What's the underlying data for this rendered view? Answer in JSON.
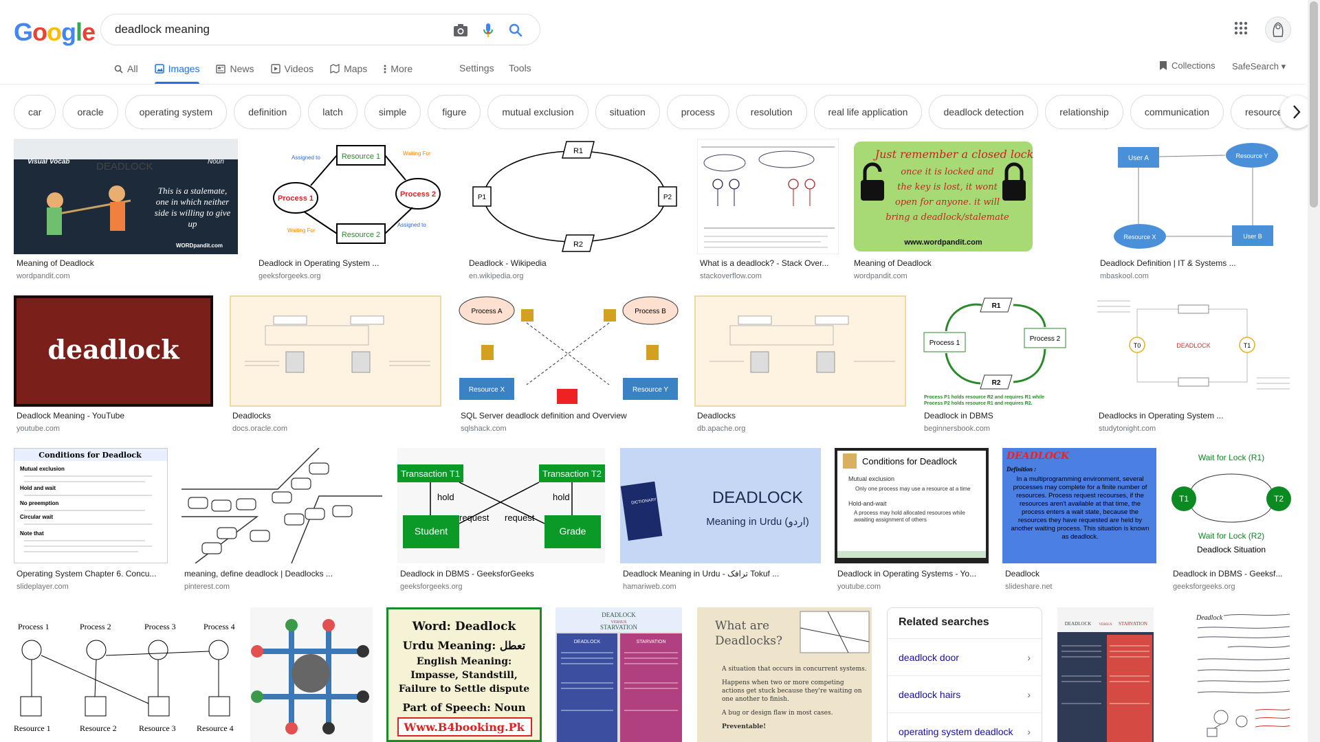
{
  "logo": "Google",
  "search": {
    "value": "deadlock meaning"
  },
  "tabs": [
    {
      "label": "All"
    },
    {
      "label": "Images"
    },
    {
      "label": "News"
    },
    {
      "label": "Videos"
    },
    {
      "label": "Maps"
    },
    {
      "label": "More"
    }
  ],
  "tools": {
    "settings": "Settings",
    "tools": "Tools"
  },
  "collections": "Collections",
  "safesearch": "SafeSearch",
  "chips": [
    "car",
    "oracle",
    "operating system",
    "definition",
    "latch",
    "simple",
    "figure",
    "mutual exclusion",
    "situation",
    "process",
    "resolution",
    "real life application",
    "deadlock detection",
    "relationship",
    "communication",
    "resource"
  ],
  "results": [
    {
      "title": "Meaning of Deadlock",
      "site": "wordpandit.com"
    },
    {
      "title": "Deadlock in Operating System ...",
      "site": "geeksforgeeks.org"
    },
    {
      "title": "Deadlock - Wikipedia",
      "site": "en.wikipedia.org"
    },
    {
      "title": "What is a deadlock? - Stack Over...",
      "site": "stackoverflow.com"
    },
    {
      "title": "Meaning of Deadlock",
      "site": "wordpandit.com"
    },
    {
      "title": "Deadlock Definition | IT & Systems ...",
      "site": "mbaskool.com"
    },
    {
      "title": "Deadlock Meaning - YouTube",
      "site": "youtube.com"
    },
    {
      "title": "Deadlocks",
      "site": "docs.oracle.com"
    },
    {
      "title": "SQL Server deadlock definition and Overview",
      "site": "sqlshack.com"
    },
    {
      "title": "Deadlocks",
      "site": "db.apache.org"
    },
    {
      "title": "Deadlock in DBMS",
      "site": "beginnersbook.com"
    },
    {
      "title": "Deadlocks in Operating System ...",
      "site": "studytonight.com"
    },
    {
      "title": "Operating System Chapter 6. Concu...",
      "site": "slideplayer.com"
    },
    {
      "title": "meaning, define deadlock | Deadlocks ...",
      "site": "pinterest.com"
    },
    {
      "title": "Deadlock in DBMS - GeeksforGeeks",
      "site": "geeksforgeeks.org"
    },
    {
      "title": "Deadlock Meaning in Urdu - ترافک Tokuf ...",
      "site": "hamariweb.com"
    },
    {
      "title": "Deadlock in Operating Systems - Yo...",
      "site": "youtube.com"
    },
    {
      "title": "Deadlock",
      "site": "slideshare.net"
    },
    {
      "title": "Deadlock in DBMS - Geeksf...",
      "site": "geeksforgeeks.org"
    }
  ],
  "thumbs": {
    "wp1": {
      "label1": "Visual Vocab",
      "label2": "DEADLOCK",
      "label3": "Noun",
      "quote": "This is a stalemate, one in which neither side is willing to give up",
      "brand": "WORDpandit.com"
    },
    "gfg1": {
      "r1": "Resource 1",
      "r2": "Resource 2",
      "p1": "Process 1",
      "p2": "Process 2",
      "a1": "Assigned to",
      "a2": "Assigned to",
      "w1": "Waiting For",
      "w2": "Waiting For"
    },
    "wiki": {
      "r1": "R1",
      "r2": "R2",
      "p1": "P1",
      "p2": "P2"
    },
    "wp2": {
      "line1": "Just remember a closed lock",
      "line2": "once it is locked and",
      "line3": "the key is lost, it wont",
      "line4": "open for anyone. it will",
      "line5": "bring a deadlock/stalemate",
      "url": "www.wordpandit.com"
    },
    "mba": {
      "ua": "User A",
      "ry": "Resource Y",
      "rx": "Resource X",
      "ub": "User B"
    },
    "yt": {
      "word": "deadlock"
    },
    "sqls": {
      "pa": "Process A",
      "pb": "Process B",
      "rx": "Resource X",
      "ry": "Resource Y"
    },
    "bb": {
      "r1": "R1",
      "r2": "R2",
      "p1": "Process 1",
      "p2": "Process 2",
      "note1": "Process P1 holds resource R2 and requires R1 while",
      "note2": "Process P2 holds resource R1 and requires R2."
    },
    "st": {
      "center": "DEADLOCK",
      "t0": "T0",
      "t1": "T1"
    },
    "sp": {
      "title": "Conditions for Deadlock",
      "c1": "Mutual exclusion",
      "c2": "Hold and wait",
      "c3": "No preemption",
      "c4": "Circular wait",
      "c5": "Note that"
    },
    "gfg2": {
      "t1": "Transaction T1",
      "t2": "Transaction T2",
      "hold1": "hold",
      "hold2": "hold",
      "req1": "request",
      "req2": "request",
      "s": "Student",
      "g": "Grade"
    },
    "urdu": {
      "big": "DEADLOCK",
      "sub": "Meaning in Urdu (اردو)",
      "book": "DICTIONARY"
    },
    "yt2": {
      "title": "Conditions for Deadlock",
      "b1": "Mutual exclusion",
      "b2": "Only one process may use a resource at a time",
      "b3": "Hold-and-wait",
      "b4": "A process may hold allocated resources while awaiting assignment of others"
    },
    "ss": {
      "title": "DEADLOCK",
      "def": "Definition :",
      "body": "In a multiprogramming environment, several processes may complete for a finite number of resources. Process request recourses, if the resources aren't available at that time, the process enters a wait state, because the resources they have requested are held by another waiting process. This situation is known as deadlock."
    },
    "gfg3": {
      "top": "Wait for Lock (R1)",
      "t1": "T1",
      "t2": "T2",
      "bot": "Wait for Lock (R2)",
      "cap": "Deadlock Situation"
    },
    "row4a": {
      "p1": "Process 1",
      "p2": "Process 2",
      "p3": "Process 3",
      "p4": "Process 4",
      "r1": "Resource 1",
      "r2": "Resource 2",
      "r3": "Resource 3",
      "r4": "Resource 4"
    },
    "b4": {
      "l1": "Word: Deadlock",
      "l2": "Urdu Meaning: تعطل",
      "l3": "English Meaning: Impasse, Standstill, Failure to Settle dispute",
      "l4": "Part of Speech: Noun",
      "url": "Www.B4booking.Pk"
    },
    "starv": {
      "h1": "DEADLOCK",
      "vs": "VERSUS",
      "h2": "STARVATION",
      "c1": "DEADLOCK",
      "c2": "STARVATION"
    },
    "what": {
      "title": "What are Deadlocks?",
      "b1": "A situation that occurs in concurrent systems.",
      "b2": "Happens when two or more competing actions get stuck because they're waiting on one another to finish.",
      "b3": "A bug or design flaw in most cases.",
      "b4": "Preventable!"
    },
    "starv2": {
      "h1": "DEADLOCK",
      "vs": "VERSUS",
      "h2": "STARVATION"
    },
    "notes": {
      "title": "Deadlock"
    }
  },
  "related": {
    "title": "Related searches",
    "items": [
      "deadlock door",
      "deadlock hairs",
      "operating system deadlock"
    ]
  }
}
